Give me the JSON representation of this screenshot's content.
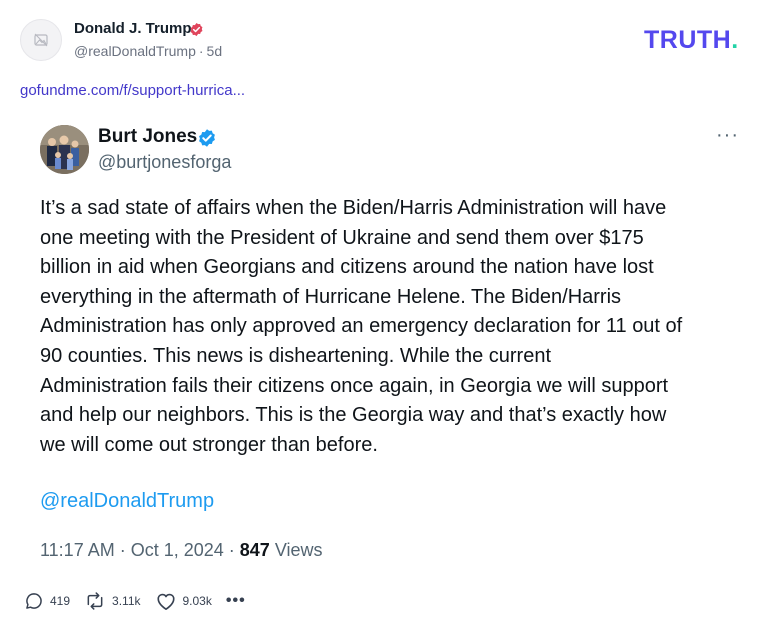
{
  "post": {
    "author_name": "Donald J. Trump",
    "handle": "@realDonaldTrump",
    "age": "5d",
    "link_text": "gofundme.com/f/support-hurrica..."
  },
  "logo": {
    "text": "TRUTH",
    "dot": "."
  },
  "embed": {
    "name": "Burt Jones",
    "handle": "@burtjonesforga",
    "more": "···",
    "text": "It’s a sad state of affairs when the Biden/Harris Administration will have\none meeting with the President of Ukraine and send them over $175\nbillion in aid when Georgians and citizens around the nation have lost\neverything in the aftermath of Hurricane Helene. The Biden/Harris\nAdministration has only approved an emergency declaration for 11 out of\n90 counties. This news is disheartening. While the current\nAdministration fails their citizens once again, in Georgia we will support\nand help our neighbors. This is the Georgia way and that’s exactly how\nwe will come out stronger than before.",
    "mention": "@realDonaldTrump",
    "time": "11:17 AM · Oct 1, 2024 · ",
    "views_count": "847",
    "views_label": " Views"
  },
  "actions": {
    "replies": "419",
    "retruths": "3.11k",
    "likes": "9.03k",
    "more": "•••"
  },
  "colors": {
    "logo": "#5448ee",
    "logo_dot": "#22d3a6",
    "link": "#4338ca",
    "mention": "#1d9bf0",
    "verified_red": "#e0455c",
    "verified_blue": "#1d9bf0"
  },
  "icons": [
    "image-placeholder-icon",
    "verified-badge-icon",
    "reply-icon",
    "retruth-icon",
    "like-icon",
    "more-icon"
  ]
}
